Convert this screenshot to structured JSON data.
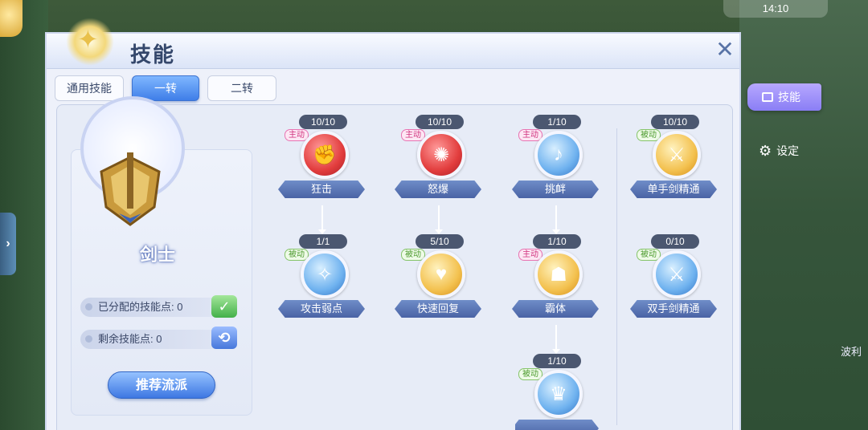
{
  "hud": {
    "time": "14:10"
  },
  "panel": {
    "title": "技能",
    "close_icon": "✕",
    "tabs": [
      {
        "label": "通用技能",
        "active": false
      },
      {
        "label": "一转",
        "active": true
      },
      {
        "label": "二转",
        "active": false
      }
    ]
  },
  "class_card": {
    "class_name": "剑士",
    "allocated_label": "已分配的技能点: 0",
    "remaining_label": "剩余技能点: 0",
    "recommend_label": "推荐流派"
  },
  "skills": [
    {
      "level": "10/10",
      "tag": "主动",
      "name": "狂击",
      "color": "red"
    },
    {
      "level": "10/10",
      "tag": "主动",
      "name": "怒爆",
      "color": "red"
    },
    {
      "level": "1/10",
      "tag": "主动",
      "name": "挑衅",
      "color": "blue"
    },
    {
      "level": "10/10",
      "tag": "被动",
      "name": "单手剑精通",
      "color": "gold"
    },
    {
      "level": "1/1",
      "tag": "被动",
      "name": "攻击弱点",
      "color": "blue"
    },
    {
      "level": "5/10",
      "tag": "被动",
      "name": "快速回复",
      "color": "gold"
    },
    {
      "level": "1/10",
      "tag": "主动",
      "name": "霸体",
      "color": "gold"
    },
    {
      "level": "0/10",
      "tag": "被动",
      "name": "双手剑精通",
      "color": "blue"
    },
    {
      "level": "1/10",
      "tag": "被动",
      "name": "",
      "color": "blue"
    }
  ],
  "sidebar": {
    "skill_tab": "技能",
    "settings": "设定",
    "bottom_label": "波利"
  }
}
